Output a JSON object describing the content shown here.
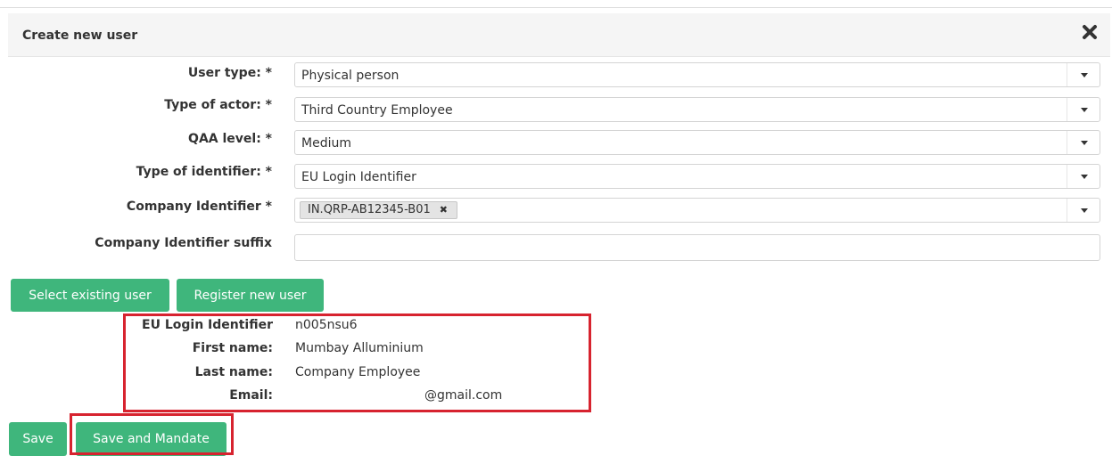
{
  "dialog": {
    "title": "Create new user",
    "close_icon": "close-icon"
  },
  "form": {
    "user_type": {
      "label": "User type: *",
      "value": "Physical person"
    },
    "actor_type": {
      "label": "Type of actor: *",
      "value": "Third Country Employee"
    },
    "qaa_level": {
      "label": "QAA level: *",
      "value": "Medium"
    },
    "identifier_type": {
      "label": "Type of identifier: *",
      "value": "EU Login Identifier"
    },
    "company_identifier": {
      "label": "Company Identifier *",
      "tag": "IN.QRP-AB12345-B01",
      "tag_remove": "✖"
    },
    "company_identifier_suffix": {
      "label": "Company Identifier suffix",
      "value": ""
    }
  },
  "buttons": {
    "select_existing": "Select existing user",
    "register_new": "Register new user",
    "save": "Save",
    "save_and_mandate": "Save and Mandate"
  },
  "user_info": {
    "eu_login_label": "EU Login Identifier",
    "eu_login_value": "n005nsu6",
    "first_name_label": "First name:",
    "first_name_value": "Mumbay Alluminium",
    "last_name_label": "Last name:",
    "last_name_value": "Company Employee",
    "email_label": "Email:",
    "email_value": "@gmail.com"
  },
  "colors": {
    "button_green": "#3fb67c",
    "highlight_red": "#d7232f",
    "header_bg": "#f5f5f5"
  }
}
